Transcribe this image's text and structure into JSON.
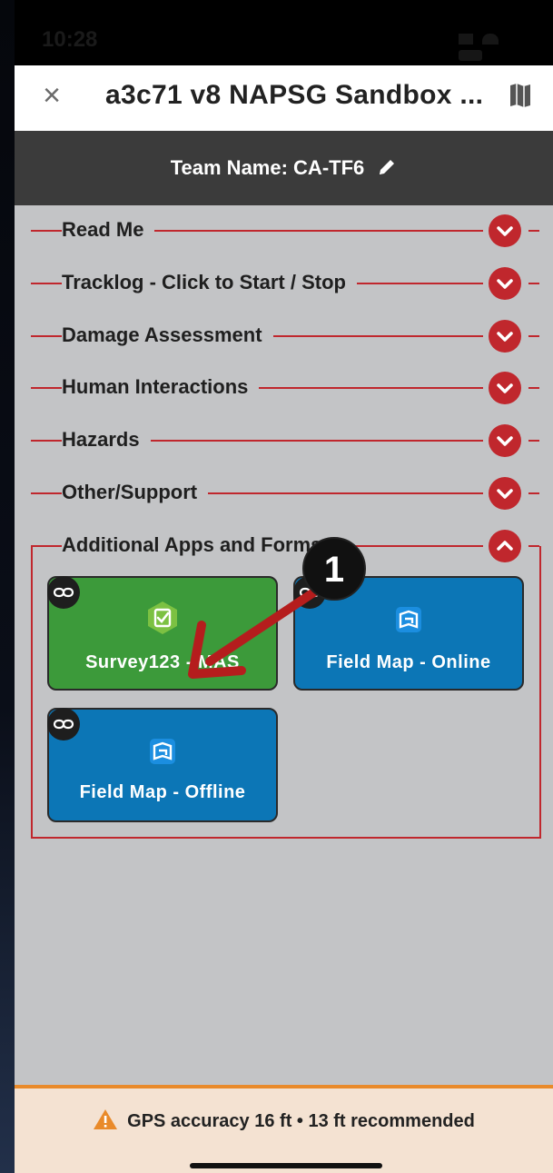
{
  "status_bar": {
    "time": "10:28"
  },
  "header": {
    "close_icon": "close-icon",
    "title": "a3c71 v8 NAPSG Sandbox ...",
    "map_icon": "map-icon"
  },
  "team": {
    "label": "Team Name: CA-TF6",
    "edit_icon": "pencil-icon"
  },
  "sections": [
    {
      "label": "Read Me",
      "state": "collapsed"
    },
    {
      "label": "Tracklog - Click to Start / Stop",
      "state": "collapsed"
    },
    {
      "label": "Damage Assessment",
      "state": "collapsed"
    },
    {
      "label": "Human Interactions",
      "state": "collapsed"
    },
    {
      "label": "Hazards",
      "state": "collapsed"
    },
    {
      "label": "Other/Support",
      "state": "collapsed"
    },
    {
      "label": "Additional Apps and Forms",
      "state": "expanded"
    }
  ],
  "tiles": [
    {
      "label": "Survey123 - MAS",
      "color": "#3c9a3a",
      "icon": "survey123-icon"
    },
    {
      "label": "Field Map - Online",
      "color": "#0c76b6",
      "icon": "field-maps-icon"
    },
    {
      "label": "Field Map - Offline",
      "color": "#0c76b6",
      "icon": "field-maps-icon"
    }
  ],
  "annotation": {
    "badge": "1",
    "arrow_color": "#b51d1d"
  },
  "gps": {
    "message": "GPS accuracy 16 ft • 13 ft recommended",
    "icon": "warning-icon"
  },
  "colors": {
    "accent_red": "#c0272d",
    "team_bar": "#3b3b3b",
    "background": "#c3c4c6",
    "gps_banner": "#f4e2d2",
    "gps_border": "#e98a2a"
  }
}
